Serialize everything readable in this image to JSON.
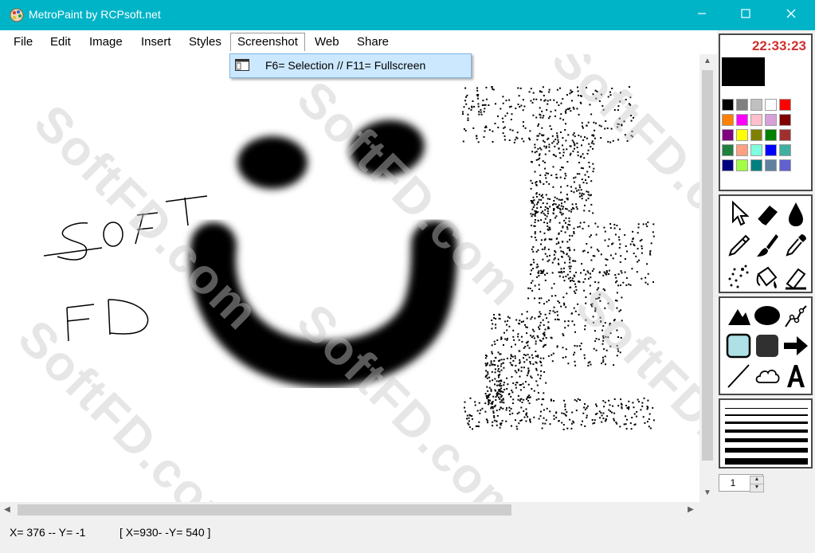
{
  "window": {
    "title": "MetroPaint by RCPsoft.net",
    "titlebar_color": "#00b4c8",
    "controls": [
      "minimize-icon",
      "maximize-icon",
      "close-icon"
    ]
  },
  "menu": {
    "items": [
      "File",
      "Edit",
      "Image",
      "Insert",
      "Styles",
      "Screenshot",
      "Web",
      "Share"
    ],
    "active": "Screenshot"
  },
  "dropdown": {
    "items": [
      {
        "label": "F6= Selection // F11= Fullscreen",
        "icon": "window-icon"
      }
    ]
  },
  "canvas": {
    "drawn_text": [
      "SoFT",
      "FD"
    ],
    "watermark": "SoftFD.com",
    "drawing": "smiley-face-with-stippled-figure"
  },
  "status": {
    "cursor": "X= 376 --  Y= -1",
    "selection": "[ X=930- -Y= 540 ]"
  },
  "panel": {
    "clock": "22:33:23",
    "current_color": "#000000",
    "palette": [
      "#000000",
      "#808080",
      "#c0c0c0",
      "#ffffff",
      "#ff0000",
      "#ff8000",
      "#ff00ff",
      "#ffc0cb",
      "#d8a0d8",
      "#800000",
      "#800080",
      "#ffff00",
      "#808000",
      "#008000",
      "#a03030",
      "#208040",
      "#ffa080",
      "#80ffe0",
      "#0000ff",
      "#40b0a0",
      "#000080",
      "#a0ff40",
      "#008080",
      "#6080a0",
      "#6060d0"
    ],
    "tools": [
      "pointer-icon",
      "eraser-icon",
      "drop-icon",
      "pencil-icon",
      "brush-icon",
      "dropper-icon",
      "spray-icon",
      "fill-bucket-icon",
      "highlighter-icon"
    ],
    "shapes": [
      "triangle-icon",
      "ellipse-icon",
      "polyline-icon",
      "rounded-rect-outline-icon",
      "rounded-rect-filled-icon",
      "arrow-icon",
      "line-icon",
      "cloud-icon",
      "text-icon"
    ],
    "line_widths": [
      1,
      2,
      3,
      4,
      5,
      6,
      8
    ],
    "stroke_size": "1"
  }
}
